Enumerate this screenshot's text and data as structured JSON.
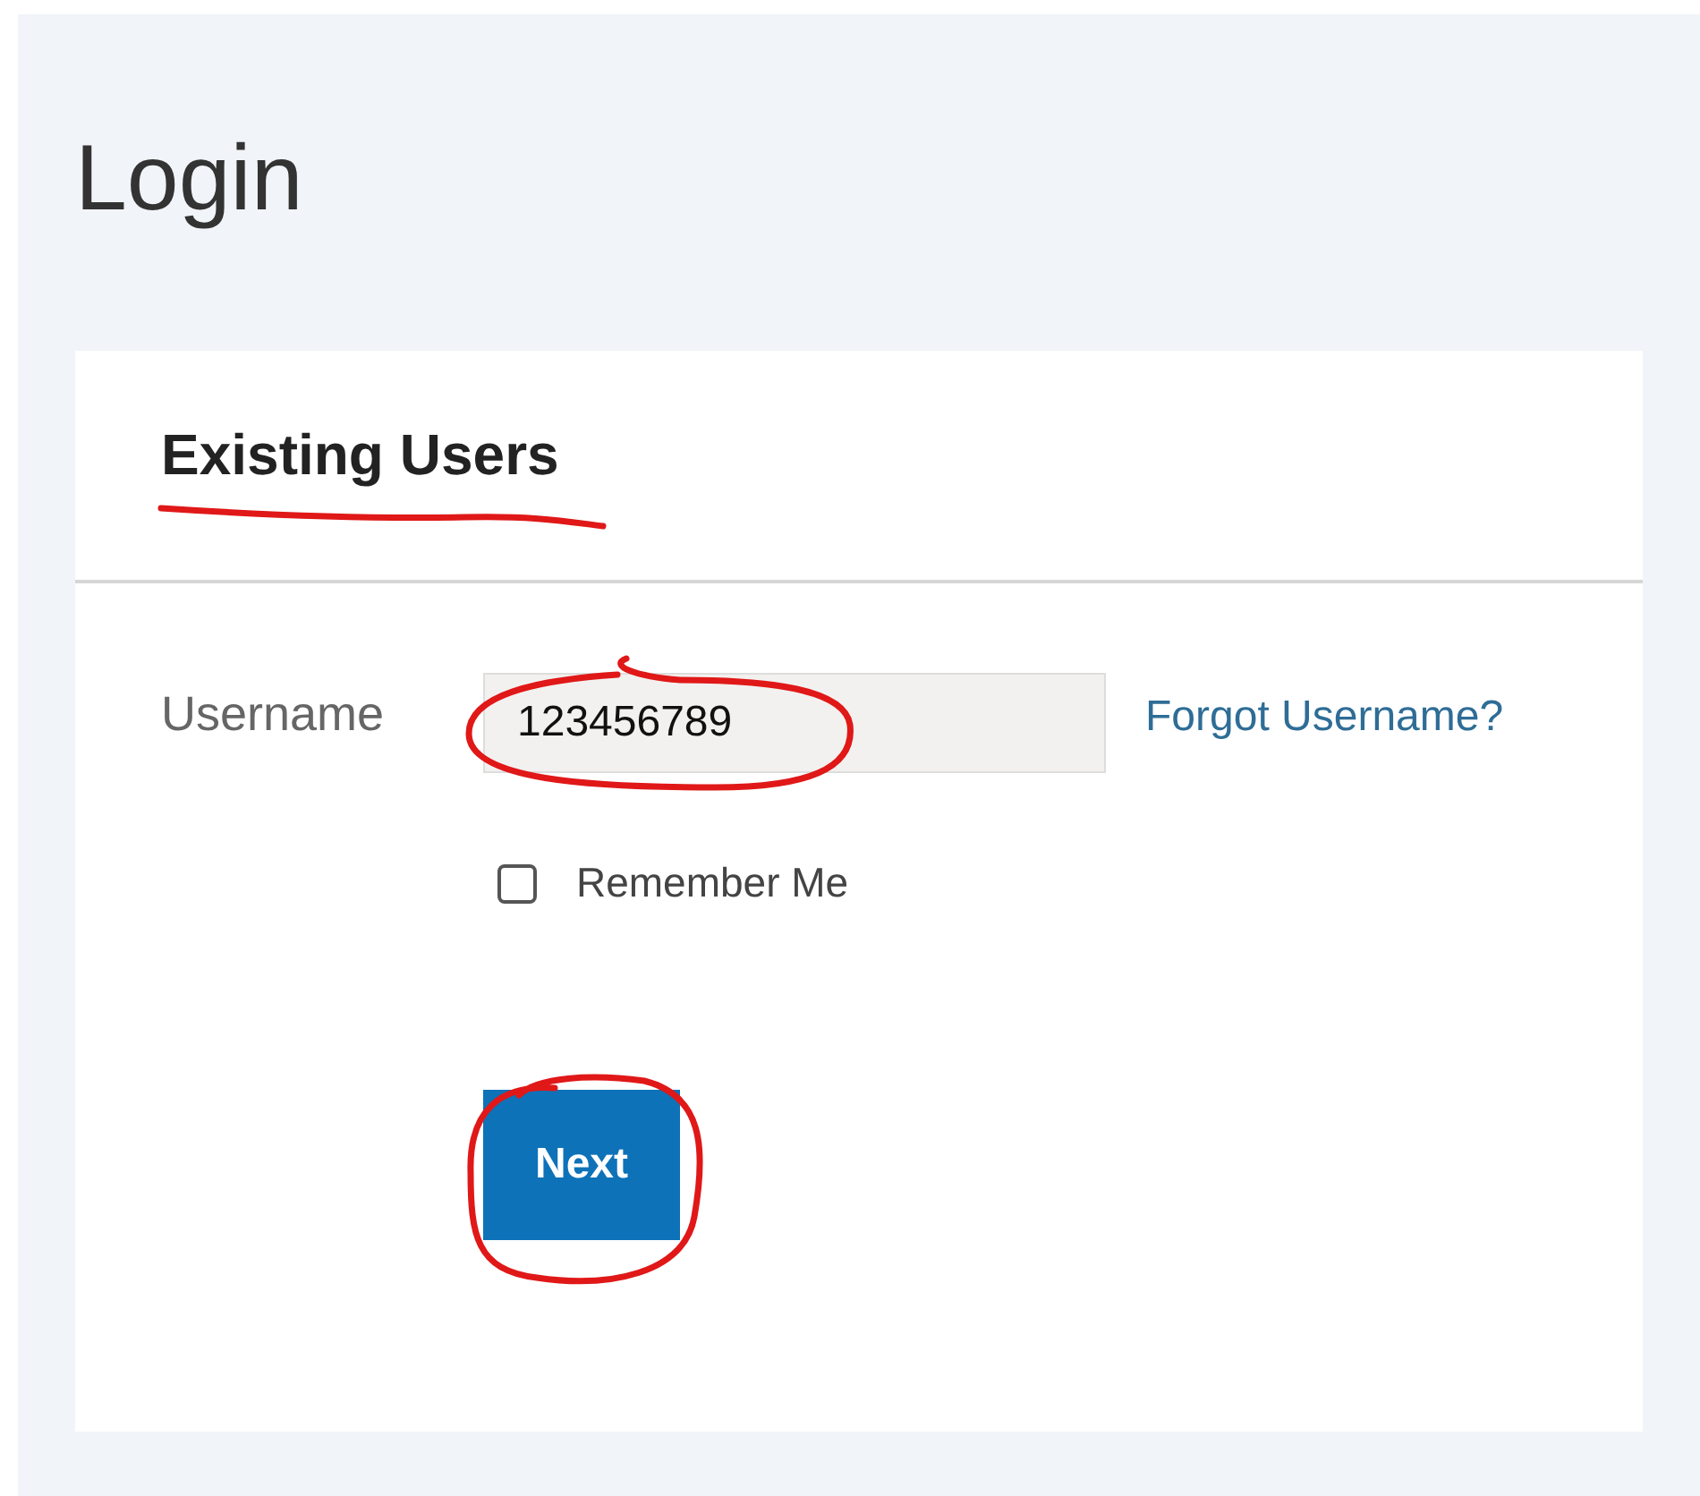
{
  "page": {
    "title": "Login"
  },
  "card": {
    "heading": "Existing Users",
    "username": {
      "label": "Username",
      "value": "123456789"
    },
    "forgot_link": "Forgot Username?",
    "remember_me": {
      "label": "Remember Me",
      "checked": false
    },
    "next_button": "Next"
  },
  "annotations": [
    {
      "kind": "underline"
    },
    {
      "kind": "circle_field"
    },
    {
      "kind": "circle_button"
    }
  ]
}
